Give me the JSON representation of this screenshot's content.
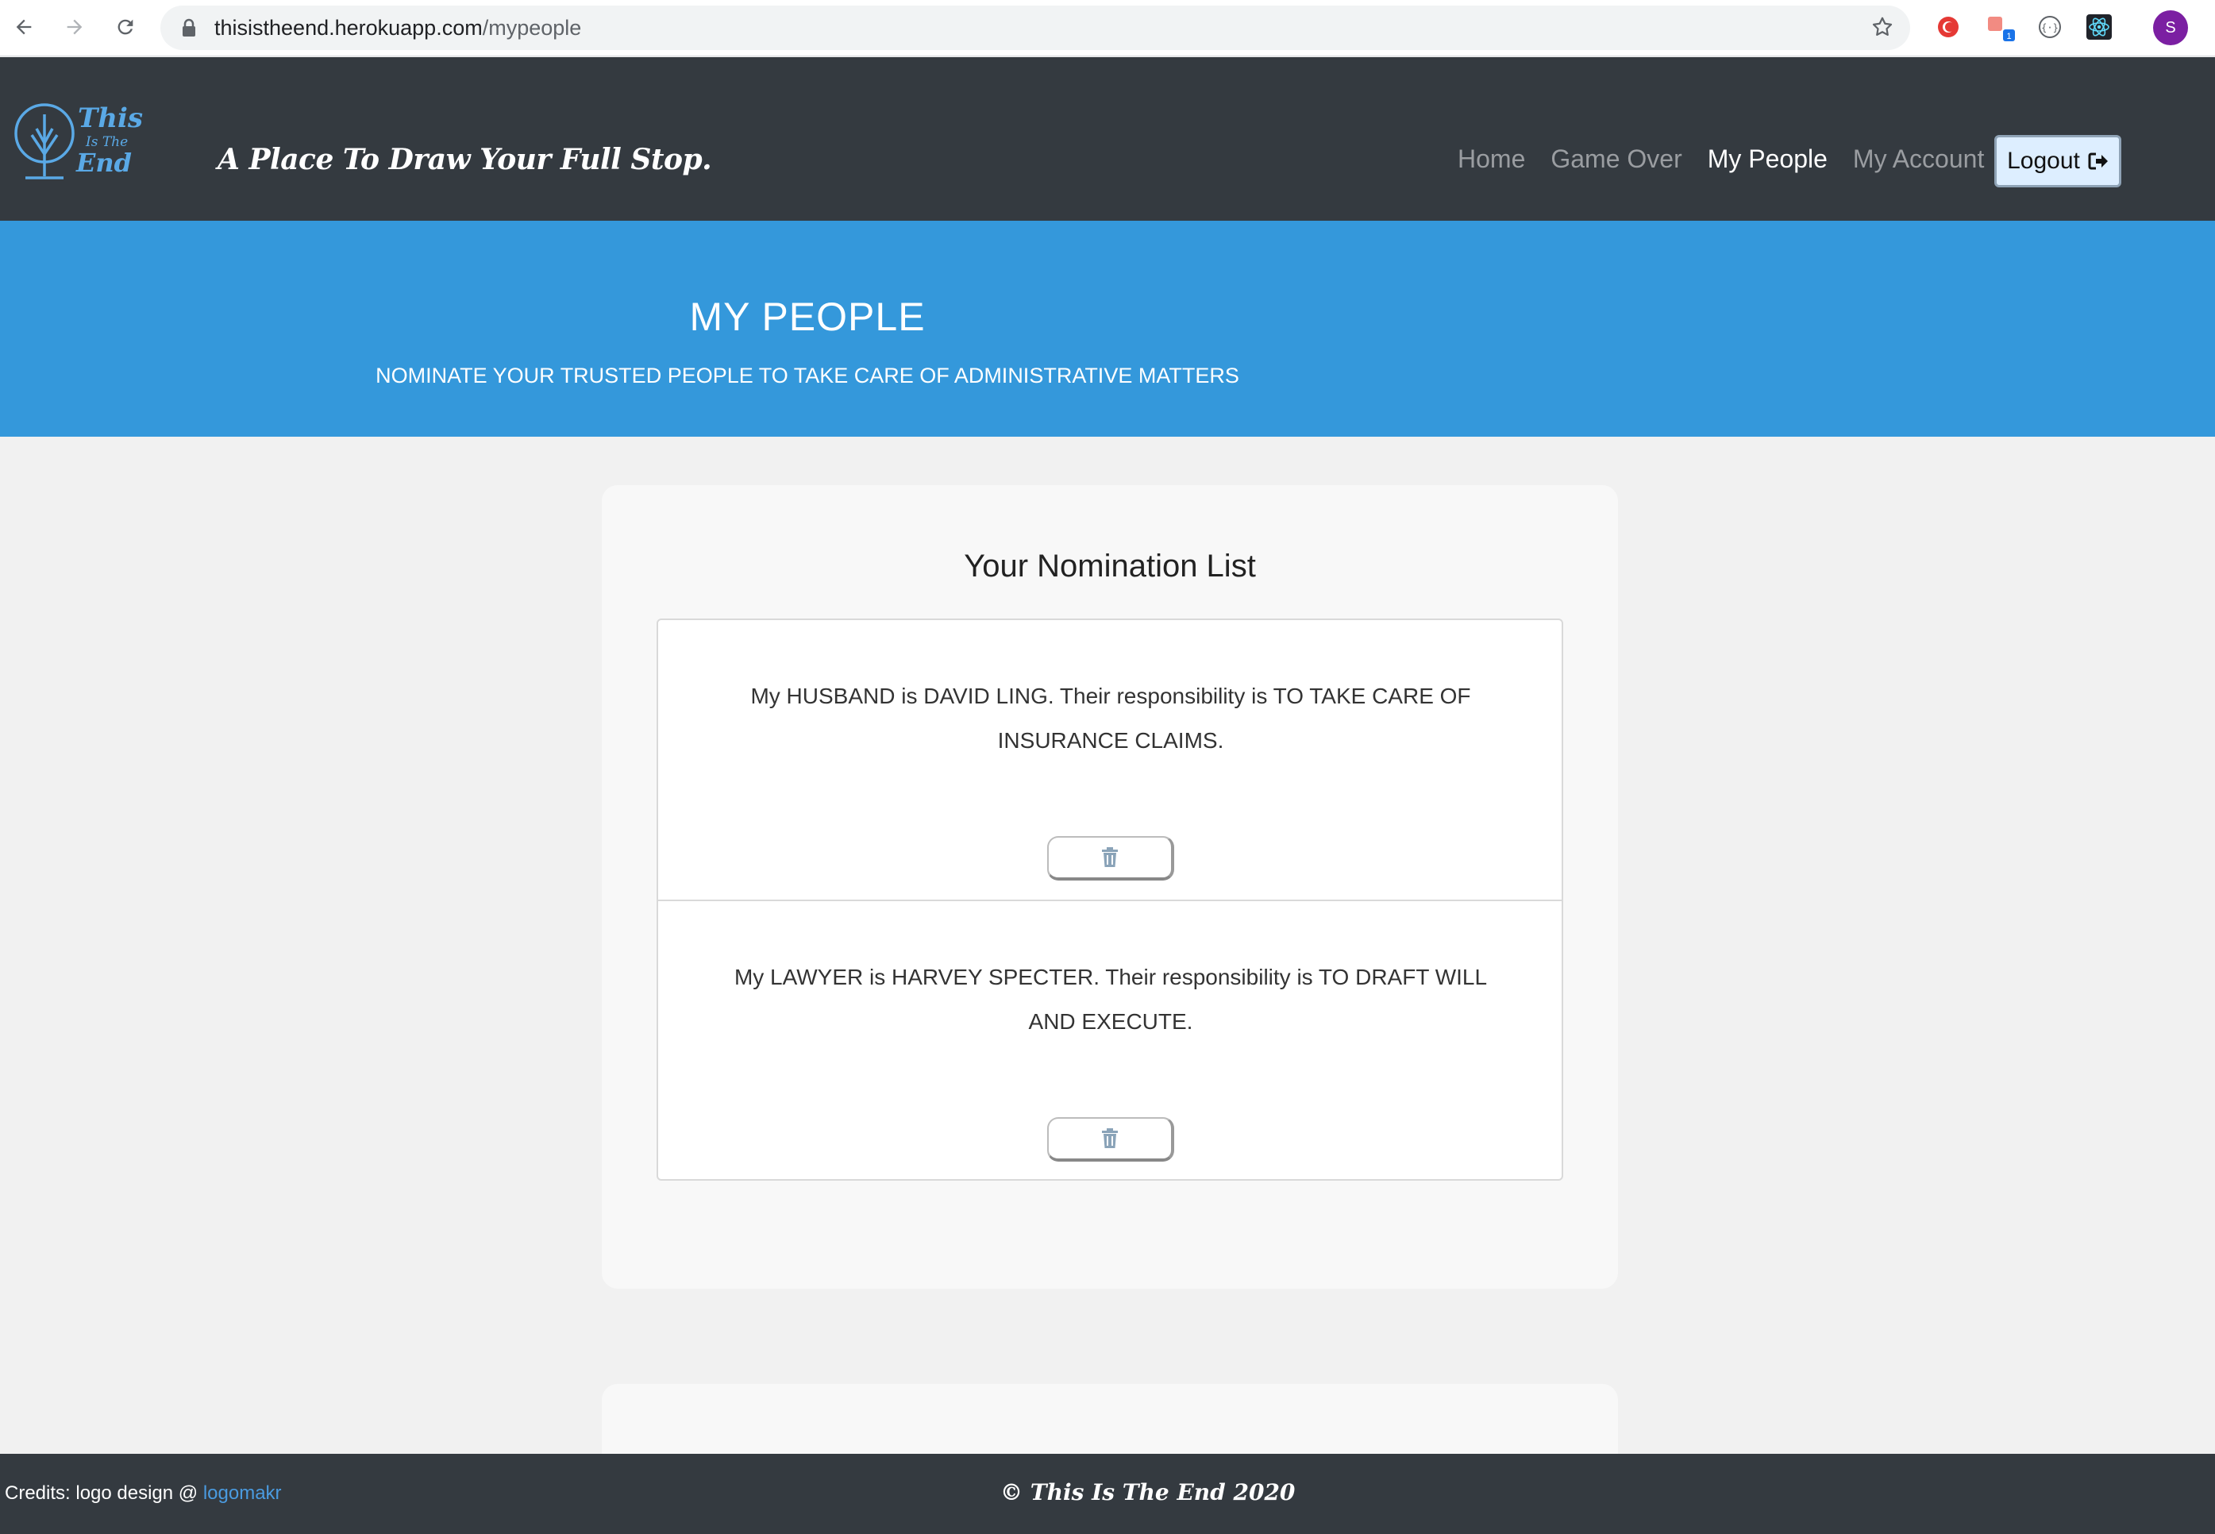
{
  "browser": {
    "url_host": "thisistheend.herokuapp.com",
    "url_path": "/mypeople",
    "profile_initial": "S",
    "extension_badge": "1"
  },
  "nav": {
    "logo_text": [
      "This",
      "Is The",
      "End"
    ],
    "tagline": "A Place To Draw Your Full Stop.",
    "links": [
      {
        "label": "Home",
        "active": false
      },
      {
        "label": "Game Over",
        "active": false
      },
      {
        "label": "My People",
        "active": true
      },
      {
        "label": "My Account",
        "active": false
      }
    ],
    "logout_label": "Logout"
  },
  "hero": {
    "title": "MY PEOPLE",
    "subtitle": "NOMINATE YOUR TRUSTED PEOPLE TO TAKE CARE OF ADMINISTRATIVE MATTERS"
  },
  "nominations": {
    "title": "Your Nomination List",
    "items": [
      {
        "text": "My HUSBAND is DAVID LING. Their responsibility is TO TAKE CARE OF INSURANCE CLAIMS."
      },
      {
        "text": "My LAWYER is HARVEY SPECTER. Their responsibility is TO DRAFT WILL AND EXECUTE."
      }
    ]
  },
  "footer": {
    "credits_prefix": "Credits: logo design @ ",
    "credits_link": "logomakr",
    "copyright": "© This Is The End 2020"
  },
  "colors": {
    "navbar": "#343a40",
    "hero": "#3498db",
    "page_bg": "#f1f1f1",
    "card_bg": "#f8f8f8",
    "link": "#4a9be0"
  }
}
